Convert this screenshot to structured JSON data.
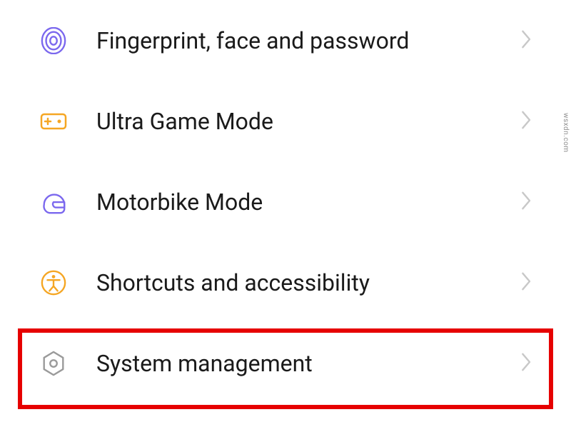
{
  "settings": {
    "items": [
      {
        "key": "fingerprint",
        "label": "Fingerprint, face and password",
        "icon": "fingerprint-icon",
        "color": "#7b68ee"
      },
      {
        "key": "ultra-game",
        "label": "Ultra Game Mode",
        "icon": "gamepad-icon",
        "color": "#f5a623"
      },
      {
        "key": "motorbike",
        "label": "Motorbike Mode",
        "icon": "helmet-icon",
        "color": "#7b68ee"
      },
      {
        "key": "shortcuts",
        "label": "Shortcuts and accessibility",
        "icon": "accessibility-icon",
        "color": "#f5a623"
      },
      {
        "key": "system",
        "label": "System management",
        "icon": "gear-hex-icon",
        "color": "#808080"
      }
    ],
    "highlighted_index": 4
  },
  "watermark": "wsxdn.com"
}
